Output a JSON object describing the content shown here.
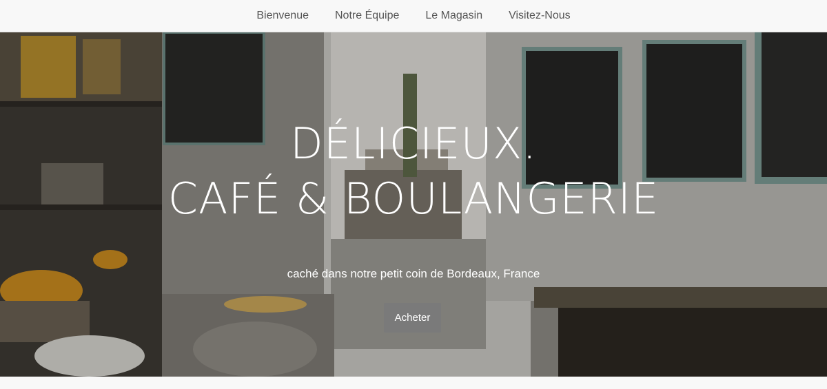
{
  "nav": {
    "items": [
      {
        "label": "Bienvenue"
      },
      {
        "label": "Notre Équipe"
      },
      {
        "label": "Le Magasin"
      },
      {
        "label": "Visitez-Nous"
      }
    ]
  },
  "hero": {
    "title_line1": "DÉLICIEUX.",
    "title_line2": "CAFÉ & BOULANGERIE",
    "subtitle": "caché dans notre petit coin de Bordeaux, France",
    "button_label": "Acheter"
  },
  "colors": {
    "nav_bg": "#f8f8f8",
    "nav_text": "#555555",
    "button_bg": "#7a7a7a",
    "hero_text": "#ffffff"
  }
}
